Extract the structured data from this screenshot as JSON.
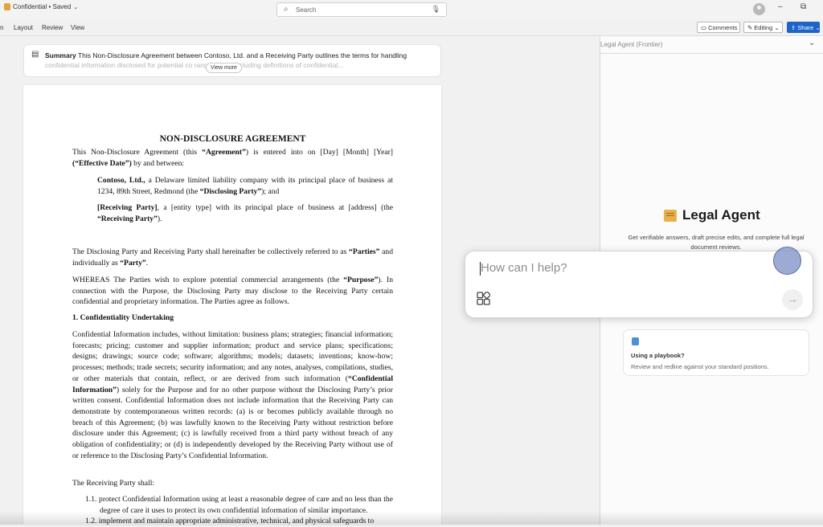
{
  "titlebar": {
    "doc_title": "Confidential • Saved",
    "search_placeholder": "Search",
    "minimize_glyph": "–",
    "restore_glyph": "⧉"
  },
  "ribbon": {
    "menu": [
      "n",
      "Layout",
      "Review",
      "View"
    ],
    "comments_label": "Comments",
    "editing_label": "Editing",
    "share_label": "Share"
  },
  "summary": {
    "label": "Summary",
    "text_line1": "This Non-Disclosure Agreement between Contoso, Ltd. and a Receiving Party outlines the terms for handling",
    "text_line2": "confidential information disclosed for potential co                      rangements, including definitions of confidential...",
    "view_more": "View more"
  },
  "document": {
    "heading": "NON-DISCLOSURE AGREEMENT",
    "intro_pre": "This Non-Disclosure Agreement (this ",
    "intro_agreement": "“Agreement”",
    "intro_post": ") is entered into on [Day] [Month] [Year]",
    "intro_date_term": "(“Effective Date”)",
    "intro_tail": " by and between:",
    "party1_name": "Contoso, Ltd.,",
    "party1_text": " a Delaware limited liability company with its principal place of business at 1234, 89th Street, Redmond (the ",
    "party1_term": "“Disclosing Party”",
    "party1_tail": "); and",
    "party2_name": "[Receiving Party]",
    "party2_text": ", a [entity type] with its principal place of business at [address] (the ",
    "party2_term": "“Receiving Party”",
    "party2_tail": ").",
    "parties_pre": "The Disclosing Party and Receiving Party shall hereinafter be collectively referred to as ",
    "parties_term": "“Parties”",
    "parties_mid": " and individually as ",
    "party_term": "“Party”",
    "parties_tail": ".",
    "whereas_pre": "WHEREAS The Parties wish to explore potential commercial arrangements (the ",
    "whereas_term": "“Purpose”",
    "whereas_post": "). In connection with the Purpose, the Disclosing Party may disclose to the Receiving Party certain confidential and proprietary information. The Parties agree as follows.",
    "section1_title": "1.   Confidentiality Undertaking",
    "ci_pre": "Confidential Information includes, without limitation: business plans; strategies; financial information; forecasts; pricing; customer and supplier information; product and service plans; specifications; designs; drawings; source code; software; algorithms; models; datasets; inventions; know-how; processes; methods; trade secrets; security information; and any notes, analyses, compilations, studies, or other materials that contain, reflect, or are derived from such information (",
    "ci_term": "“Confidential Information”",
    "ci_post": ") solely for the Purpose and for no other purpose without the Disclosing Party’s prior written consent. Confidential Information does not include information that the Receiving Party can demonstrate by contemporaneous written records: (a) is or becomes publicly available through no breach of this Agreement; (b) was lawfully known to the Receiving Party without restriction before disclosure under this Agreement; (c) is lawfully received from a third party without breach of any obligation of confidentiality; or (d) is independently developed by the Receiving Party without use of or reference to the Disclosing Party’s Confidential Information.",
    "shall": "The Receiving Party shall:",
    "item1": "1.1.  protect Confidential Information using at least a reasonable degree of care and no less than the degree of care it uses to protect its own confidential information of similar importance.",
    "item2": "1.2.  implement and maintain appropriate administrative, technical, and physical safeguards to"
  },
  "legal_agent": {
    "pane_title": "Legal Agent (Frontier)",
    "title": "Legal Agent",
    "description": "Get verifiable answers, draft precise edits, and complete full legal document reviews.",
    "input_placeholder": "How can I help?",
    "playbook_title": "Using a playbook?",
    "playbook_desc": "Review and redline against your standard positions."
  },
  "colors": {
    "accent": "#1c64c8",
    "page_bg": "#f1f1f1",
    "app_icon": "#e6a23c"
  },
  "icons": [
    "app-icon",
    "chevron-down-icon",
    "search-icon",
    "microphone-icon",
    "avatar",
    "comment-icon",
    "pencil-icon",
    "share-icon",
    "summary-icon",
    "scroll-icon",
    "prompts-grid-icon",
    "send-arrow-icon",
    "playbook-icon"
  ]
}
